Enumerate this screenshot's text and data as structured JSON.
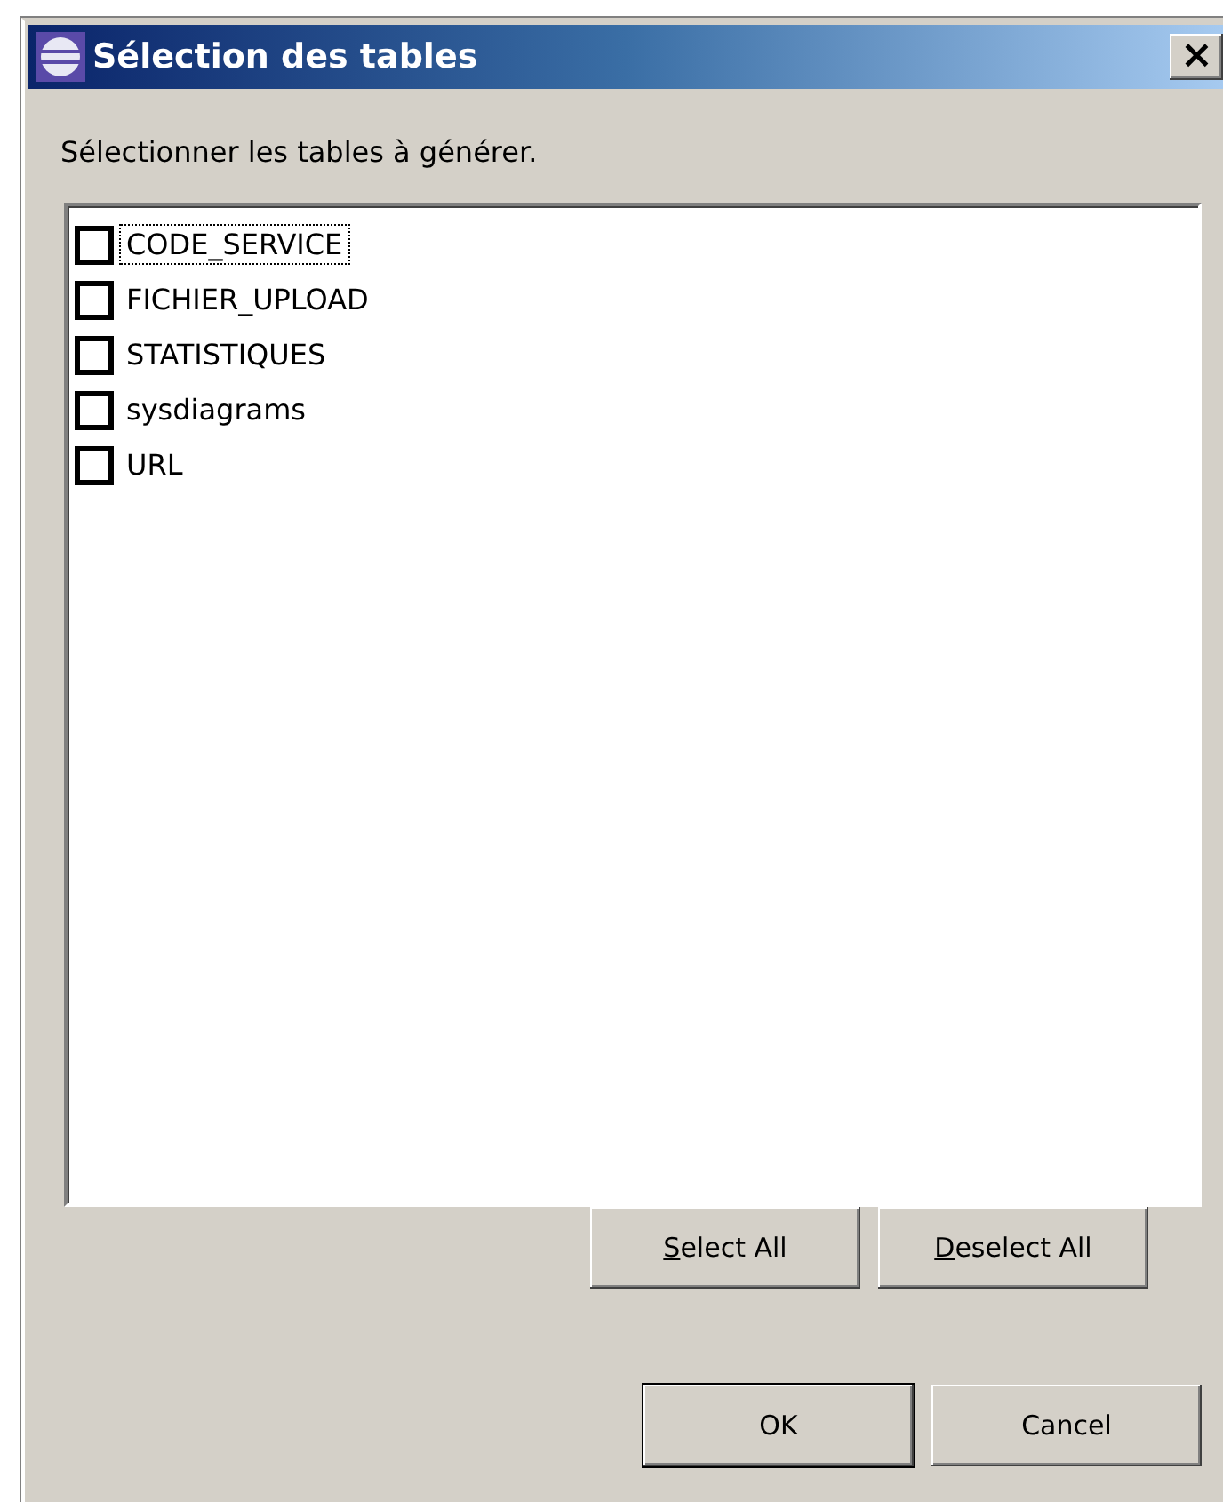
{
  "window": {
    "title": "Sélection des tables",
    "close": "×"
  },
  "prompt": "Sélectionner les tables à générer.",
  "tables": [
    {
      "label": "CODE_SERVICE",
      "checked": false,
      "focused": true
    },
    {
      "label": "FICHIER_UPLOAD",
      "checked": false,
      "focused": false
    },
    {
      "label": "STATISTIQUES",
      "checked": false,
      "focused": false
    },
    {
      "label": "sysdiagrams",
      "checked": false,
      "focused": false
    },
    {
      "label": "URL",
      "checked": false,
      "focused": false
    }
  ],
  "selection_buttons": [
    {
      "label": "Select All",
      "mnemonic": true
    },
    {
      "label": "Deselect All",
      "mnemonic": true
    }
  ],
  "dialog_buttons": [
    {
      "label": "OK",
      "default": true
    },
    {
      "label": "Cancel",
      "default": false
    }
  ]
}
